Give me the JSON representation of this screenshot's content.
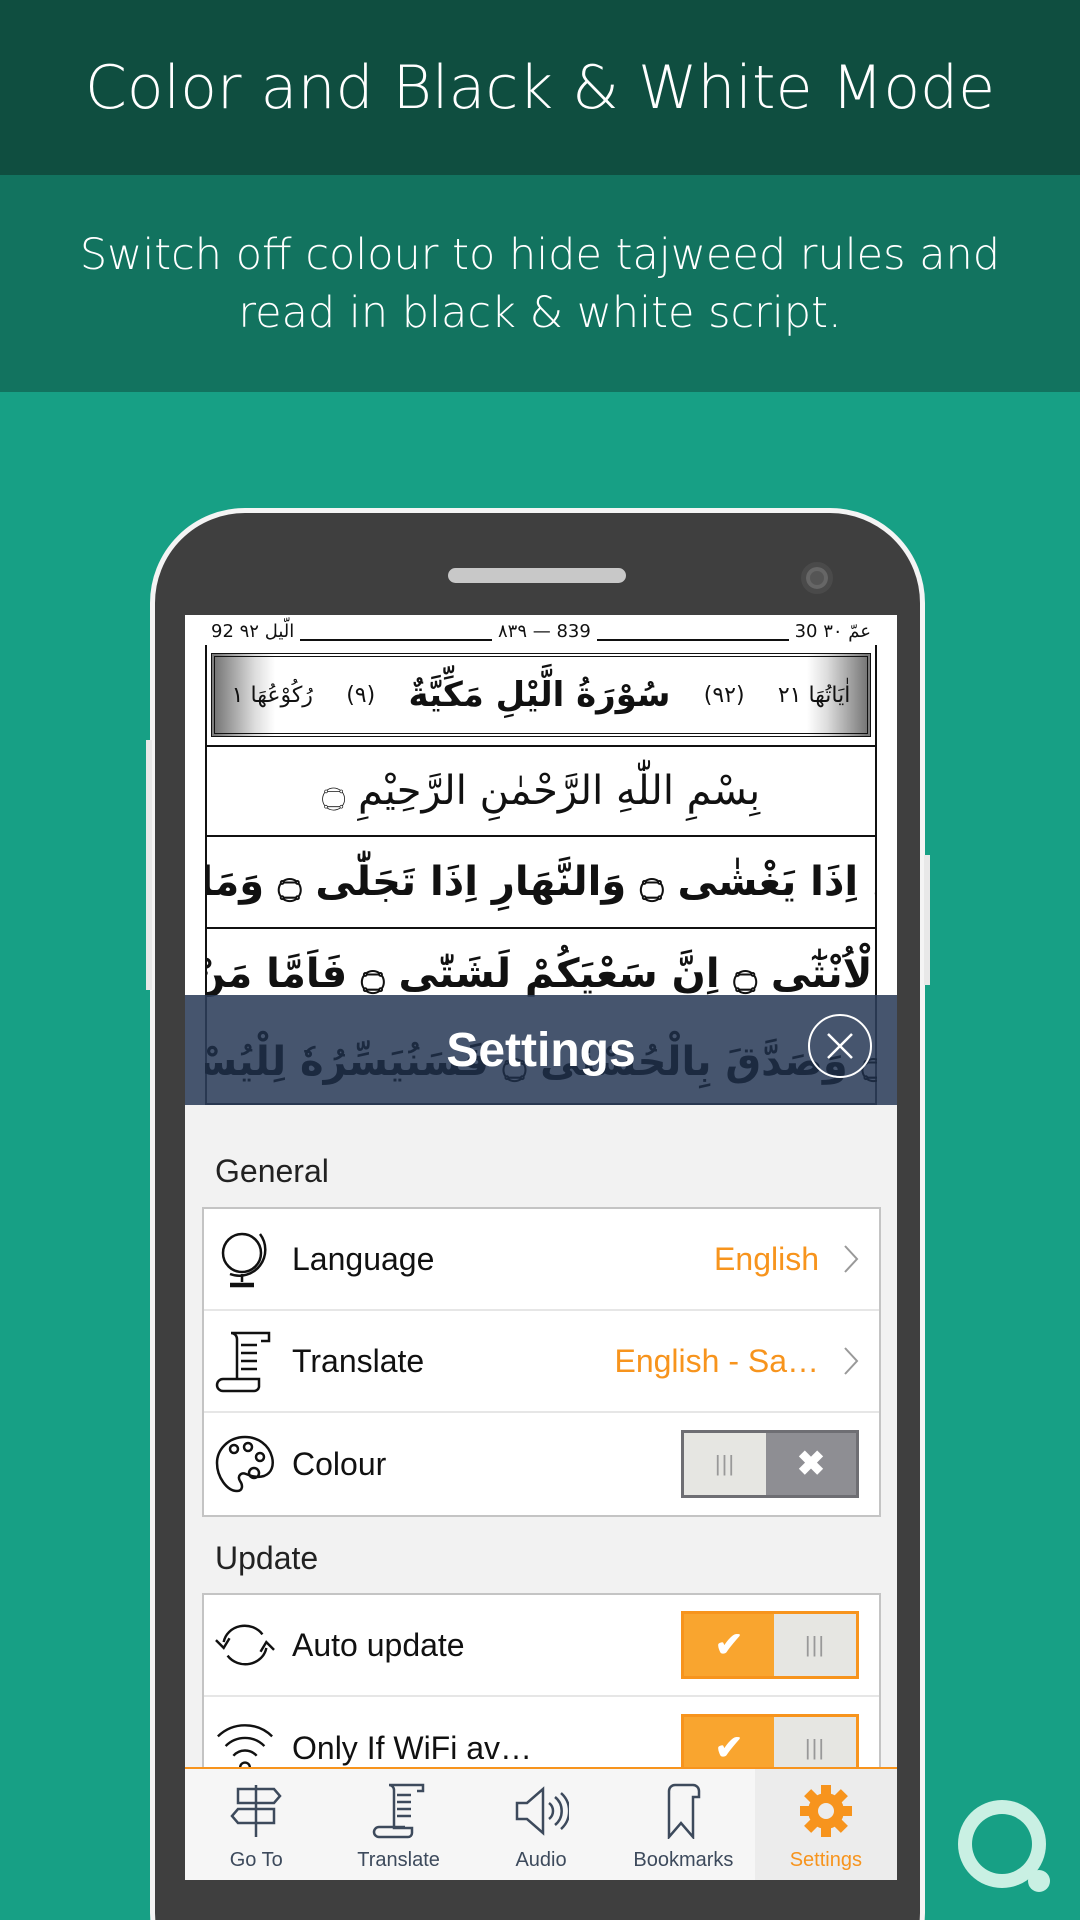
{
  "header": {
    "title": "Color and Black & White Mode"
  },
  "subheader": {
    "line1": "Switch off colour to hide tajweed rules and",
    "line2": "read in black & white script."
  },
  "quran_page": {
    "top_left": "92 الّيل ٩٢",
    "top_center": "٨٣٩ — 839",
    "top_right": "30 عمّ ٣٠",
    "ayat_count": "اٰيَاتُهَا ٢١",
    "surah_no": "(٩٢)",
    "surah_name": "سُوْرَةُ الَّيْلِ مَكِّيَّةٌ",
    "order_no": "(٩)",
    "ruku_count": "رُكُوْعُهَا ١",
    "bismillah": "بِسْمِ اللّٰهِ الرَّحْمٰنِ الرَّحِيْمِ ۝",
    "lines": [
      "وَالَّيْلِ اِذَا يَغْشٰى ۝ وَالنَّهَارِ اِذَا تَجَلّٰى ۝ وَمَا خَلَقَ",
      "الذَّكَرَ وَالْاُنْثٰٓى ۝ اِنَّ سَعْيَكُمْ لَشَتّٰى ۝ فَاَمَّا مَنْ اَعْطٰى",
      "وَاتَّقٰى ۝ وَصَدَّقَ بِالْحُسْنٰى ۝ فَسَنُيَسِّرُهٗ لِلْيُسْرٰى ۝ وَ"
    ]
  },
  "settings": {
    "title": "Settings",
    "general": {
      "label": "General",
      "language": {
        "label": "Language",
        "value": "English"
      },
      "translate": {
        "label": "Translate",
        "value": "English - Sa…"
      },
      "colour": {
        "label": "Colour",
        "enabled": false
      }
    },
    "update": {
      "label": "Update",
      "auto_update": {
        "label": "Auto update",
        "enabled": true
      },
      "wifi_only": {
        "label": "Only If WiFi av…",
        "enabled": true
      }
    }
  },
  "tabs": [
    {
      "label": "Go To",
      "icon": "signpost-icon"
    },
    {
      "label": "Translate",
      "icon": "scroll-icon"
    },
    {
      "label": "Audio",
      "icon": "speaker-icon"
    },
    {
      "label": "Bookmarks",
      "icon": "bookmark-icon"
    },
    {
      "label": "Settings",
      "icon": "gear-icon",
      "active": true
    }
  ],
  "colors": {
    "accent": "#f7941d",
    "background": "#17a085",
    "header": "#0f4e40",
    "subheader": "#12735f"
  }
}
